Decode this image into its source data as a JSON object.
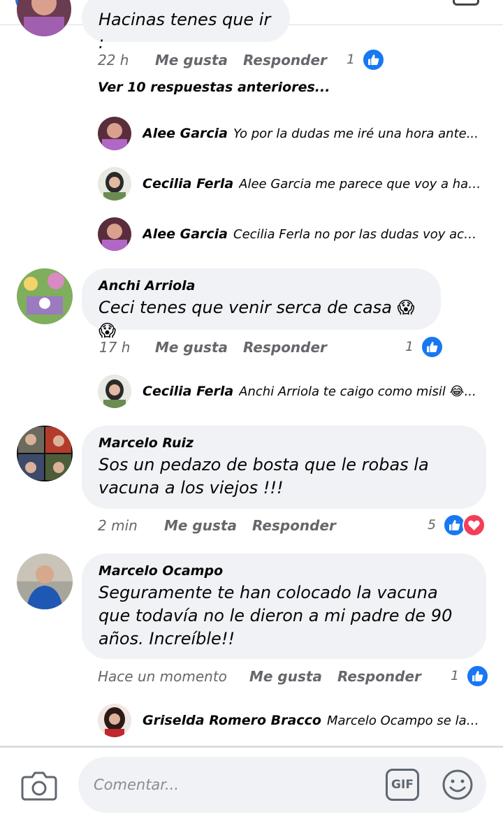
{
  "colors": {
    "like_blue": "#1877f2",
    "love_red": "#f33e58",
    "bubble_bg": "#f0f2f5",
    "meta_gray": "#65676b"
  },
  "top_comment": {
    "partial_text": "Hacinas tenes que ir :",
    "time": "22 h",
    "like_label": "Me gusta",
    "reply_label": "Responder",
    "reaction_count": "1",
    "reaction_icons": [
      "like-icon"
    ]
  },
  "more_replies_label": "Ver 10 respuestas anteriores...",
  "replies_a": [
    {
      "author": "Alee Garcia",
      "text": "Yo por la dudas me iré una hora ante..."
    },
    {
      "author": "Cecilia Ferla",
      "text": "Alee Garcia me parece que voy a hac..."
    },
    {
      "author": "Alee Garcia",
      "text": "Cecilia Ferla no por las dudas voy aco..."
    }
  ],
  "comment_anchi": {
    "author": "Anchi Arriola",
    "text": "Ceci tenes que venir serca de casa 😱😱",
    "time": "17 h",
    "like_label": "Me gusta",
    "reply_label": "Responder",
    "reaction_count": "1",
    "reaction_icons": [
      "like-icon"
    ]
  },
  "reply_anchi": {
    "author": "Cecilia Ferla",
    "text": "Anchi Arriola te caigo como misil 😂..."
  },
  "comment_marcelo_ruiz": {
    "author": "Marcelo Ruiz",
    "text": "Sos un pedazo de bosta que le robas la vacuna a los viejos !!!",
    "time": "2 min",
    "like_label": "Me gusta",
    "reply_label": "Responder",
    "reaction_count": "5",
    "reaction_icons": [
      "like-icon",
      "love-icon"
    ]
  },
  "comment_marcelo_ocampo": {
    "author": "Marcelo Ocampo",
    "text": "Seguramente te han colocado la vacuna que todavía no le dieron a mi padre de 90 años. Increíble!!",
    "time": "Hace un momento",
    "like_label": "Me gusta",
    "reply_label": "Responder",
    "reaction_count": "1",
    "reaction_icons": [
      "like-icon"
    ]
  },
  "reply_ocampo": {
    "author": "Griselda Romero Bracco",
    "text": "Marcelo Ocampo se la po..."
  },
  "composer": {
    "placeholder": "Comentar...",
    "gif_label": "GIF",
    "icons": [
      "camera-icon",
      "gif-icon",
      "emoji-icon"
    ]
  }
}
